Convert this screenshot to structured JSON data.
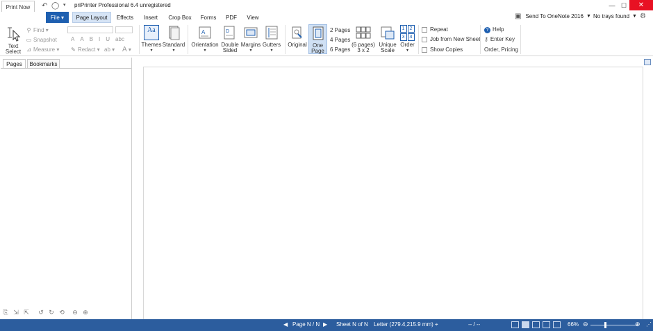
{
  "titlebar": {
    "print_now": "Print Now",
    "app_title": "priPrinter Professional 6.4 unregistered",
    "minimize": "—",
    "maximize": "☐",
    "close": "✕"
  },
  "menu": {
    "tabs": [
      "File ▾",
      "Page Layout",
      "Effects",
      "Insert",
      "Crop Box",
      "Forms",
      "PDF",
      "View"
    ],
    "active": "Page Layout",
    "printer": "Send To OneNote 2016",
    "trays": "No trays found"
  },
  "ribbon": {
    "text_select": [
      "Text",
      "Select"
    ],
    "find": "Find",
    "snapshot": "Snapshot",
    "measure": "Measure",
    "redact": "Redact",
    "format_glyphs": [
      "A",
      "A",
      "B",
      "I",
      "U",
      "abc"
    ],
    "themes": "Themes",
    "standard": "Standard",
    "orientation": "Orientation",
    "double_sided": [
      "Double",
      "Sided"
    ],
    "margins": "Margins",
    "gutters": "Gutters",
    "original": "Original",
    "one_page": [
      "One",
      "Page"
    ],
    "pages_options": [
      "2 Pages",
      "4 Pages",
      "6 Pages"
    ],
    "six_pages": [
      "(6 pages)",
      "3 x 2"
    ],
    "unique_scale": [
      "Unique",
      "Scale"
    ],
    "order": "Order",
    "order_grid": [
      "1",
      "2",
      "3",
      "4"
    ],
    "repeat": "Repeat",
    "job_from_new_sheet": "Job from New Sheet",
    "show_copies": "Show Copies",
    "help": "Help",
    "enter_key": "Enter Key",
    "order_pricing": "Order, Pricing"
  },
  "left_panel": {
    "tabs": [
      "Pages",
      "Bookmarks"
    ]
  },
  "statusbar": {
    "page": "Page N / N",
    "sheet": "Sheet N of N",
    "paper": "Letter (279.4,215.9 mm)",
    "position": "-- / --",
    "zoom": "66%"
  },
  "colors": {
    "accent": "#1e5fb0",
    "statusbar": "#2c5d9e",
    "close": "#e81123"
  }
}
